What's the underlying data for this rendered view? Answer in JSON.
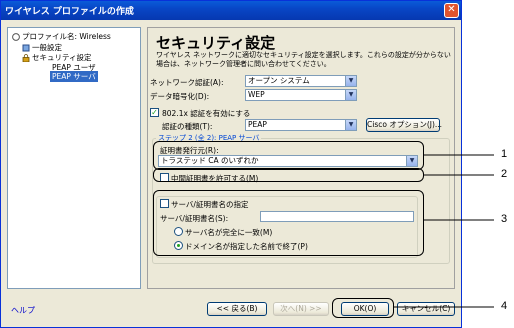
{
  "window": {
    "title": "ワイヤレス プロファイルの作成",
    "close": "✕"
  },
  "tree": {
    "profile": "プロファイル名: Wireless",
    "general": "一般設定",
    "security": "セキュリティ設定",
    "peap_user": "PEAP ユーザ",
    "peap_server": "PEAP サーバ"
  },
  "help": "ヘルプ",
  "main": {
    "heading": "セキュリティ設定",
    "description": "ワイヤレス ネットワークに適切なセキュリティ設定を選択します。これらの設定が分からない場合は、ネットワーク管理者に問い合わせてください。",
    "network_auth_label": "ネットワーク認証(A):",
    "network_auth_value": "オープン システム",
    "data_enc_label": "データ暗号化(D):",
    "data_enc_value": "WEP",
    "enable_8021x_label": "802.1x 認証を有効にする",
    "enable_8021x_checked": true,
    "auth_type_label": "認証の種類(T):",
    "auth_type_value": "PEAP",
    "cisco_button": "Cisco オプション(J)...",
    "step_title": "ステップ 2 (全 2): PEAP サーバ",
    "cert_issuer_label": "証明書発行元(R):",
    "cert_issuer_value": "トラステッド CA のいずれか",
    "allow_intermediate_label": "中間証明書を許可する(M)",
    "allow_intermediate_checked": false,
    "specify_server_label": "サーバ/証明書名の指定",
    "specify_server_checked": false,
    "server_name_label": "サーバ/証明書名(S):",
    "server_name_value": "",
    "radio_exact": "サーバ名が完全に一致(M)",
    "radio_domain": "ドメイン名が指定した名前で終了(P)",
    "radio_selected": "domain"
  },
  "footer": {
    "back": "<< 戻る(B)",
    "next": "次へ(N) >>",
    "ok": "OK(O)",
    "cancel": "キャンセル(C)"
  },
  "callouts": [
    "1",
    "2",
    "3",
    "4"
  ]
}
